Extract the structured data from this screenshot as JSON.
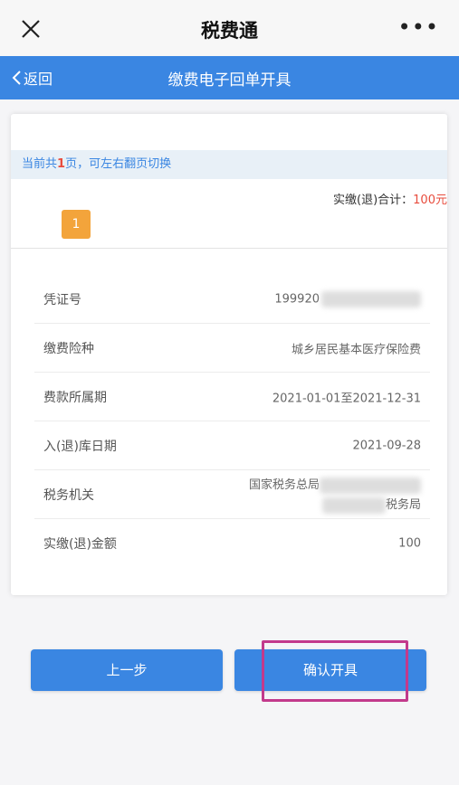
{
  "app": {
    "title": "税费通"
  },
  "nav": {
    "back_label": "返回",
    "page_title": "缴费电子回单开具"
  },
  "card": {
    "hint_prefix": "当前共",
    "hint_count": "1",
    "hint_suffix": "页，可左右翻页切换",
    "total_label": "实缴(退)合计：",
    "total_amount": "100",
    "total_unit": "元",
    "page_tab": "1",
    "rows": [
      {
        "label": "凭证号",
        "value": "199920"
      },
      {
        "label": "缴费险种",
        "value": "城乡居民基本医疗保险费"
      },
      {
        "label": "费款所属期",
        "value": "2021-01-01至2021-12-31"
      },
      {
        "label": "入(退)库日期",
        "value": "2021-09-28"
      },
      {
        "label": "税务机关",
        "value_line1": "国家税务总局",
        "value_line2": "税务局"
      },
      {
        "label": "实缴(退)金额",
        "value": "100"
      }
    ]
  },
  "buttons": {
    "prev_label": "上一步",
    "confirm_label": "确认开具"
  }
}
